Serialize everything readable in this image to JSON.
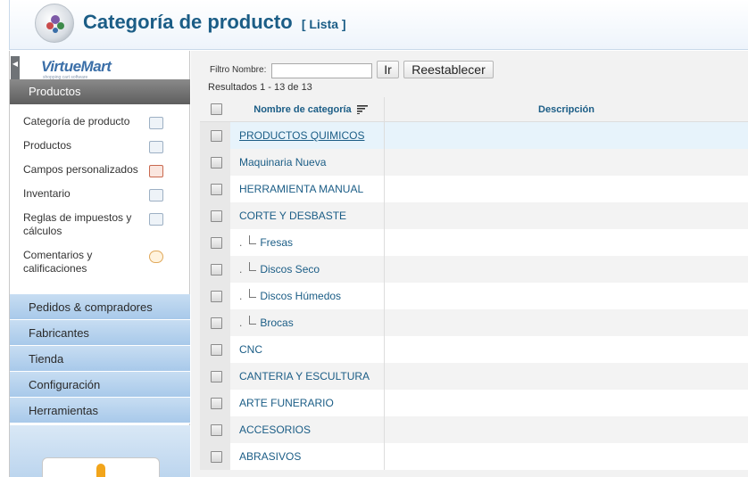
{
  "header": {
    "title": "Categoría de producto",
    "subtitle": "[ Lista ]"
  },
  "sidebar": {
    "logo": "VirtueMart",
    "logo_tagline": "shopping cart software",
    "section_title": "Productos",
    "items": [
      {
        "label": "Categoría de producto",
        "icon": "folder-icon"
      },
      {
        "label": "Productos",
        "icon": "camera-icon"
      },
      {
        "label": "Campos personalizados",
        "icon": "custom-fields-icon"
      },
      {
        "label": "Inventario",
        "icon": "inventory-icon"
      },
      {
        "label": "Reglas de impuestos y cálculos",
        "icon": "calculator-icon"
      },
      {
        "label": "Comentarios y calificaciones",
        "icon": "comment-bubble-icon"
      }
    ],
    "groups": [
      {
        "label": "Pedidos & compradores"
      },
      {
        "label": "Fabricantes"
      },
      {
        "label": "Tienda"
      },
      {
        "label": "Configuración"
      },
      {
        "label": "Herramientas"
      }
    ]
  },
  "toolbar": {
    "filter_label": "Filtro Nombre:",
    "filter_value": "",
    "go_label": "Ir",
    "reset_label": "Reestablecer",
    "results_text": "Resultados 1 - 13 de 13"
  },
  "table": {
    "col_name": "Nombre de categoría",
    "col_desc": "Descripción",
    "rows": [
      {
        "name": "PRODUCTOS QUIMICOS",
        "child": false,
        "highlight": true
      },
      {
        "name": "Maquinaria Nueva",
        "child": false
      },
      {
        "name": "HERRAMIENTA MANUAL",
        "child": false
      },
      {
        "name": "CORTE Y DESBASTE",
        "child": false
      },
      {
        "name": "Fresas",
        "child": true
      },
      {
        "name": "Discos Seco",
        "child": true
      },
      {
        "name": "Discos Húmedos",
        "child": true
      },
      {
        "name": "Brocas",
        "child": true
      },
      {
        "name": "CNC",
        "child": false
      },
      {
        "name": "CANTERIA Y ESCULTURA",
        "child": false
      },
      {
        "name": "ARTE FUNERARIO",
        "child": false
      },
      {
        "name": "ACCESORIOS",
        "child": false
      },
      {
        "name": "ABRASIVOS",
        "child": false
      }
    ]
  }
}
